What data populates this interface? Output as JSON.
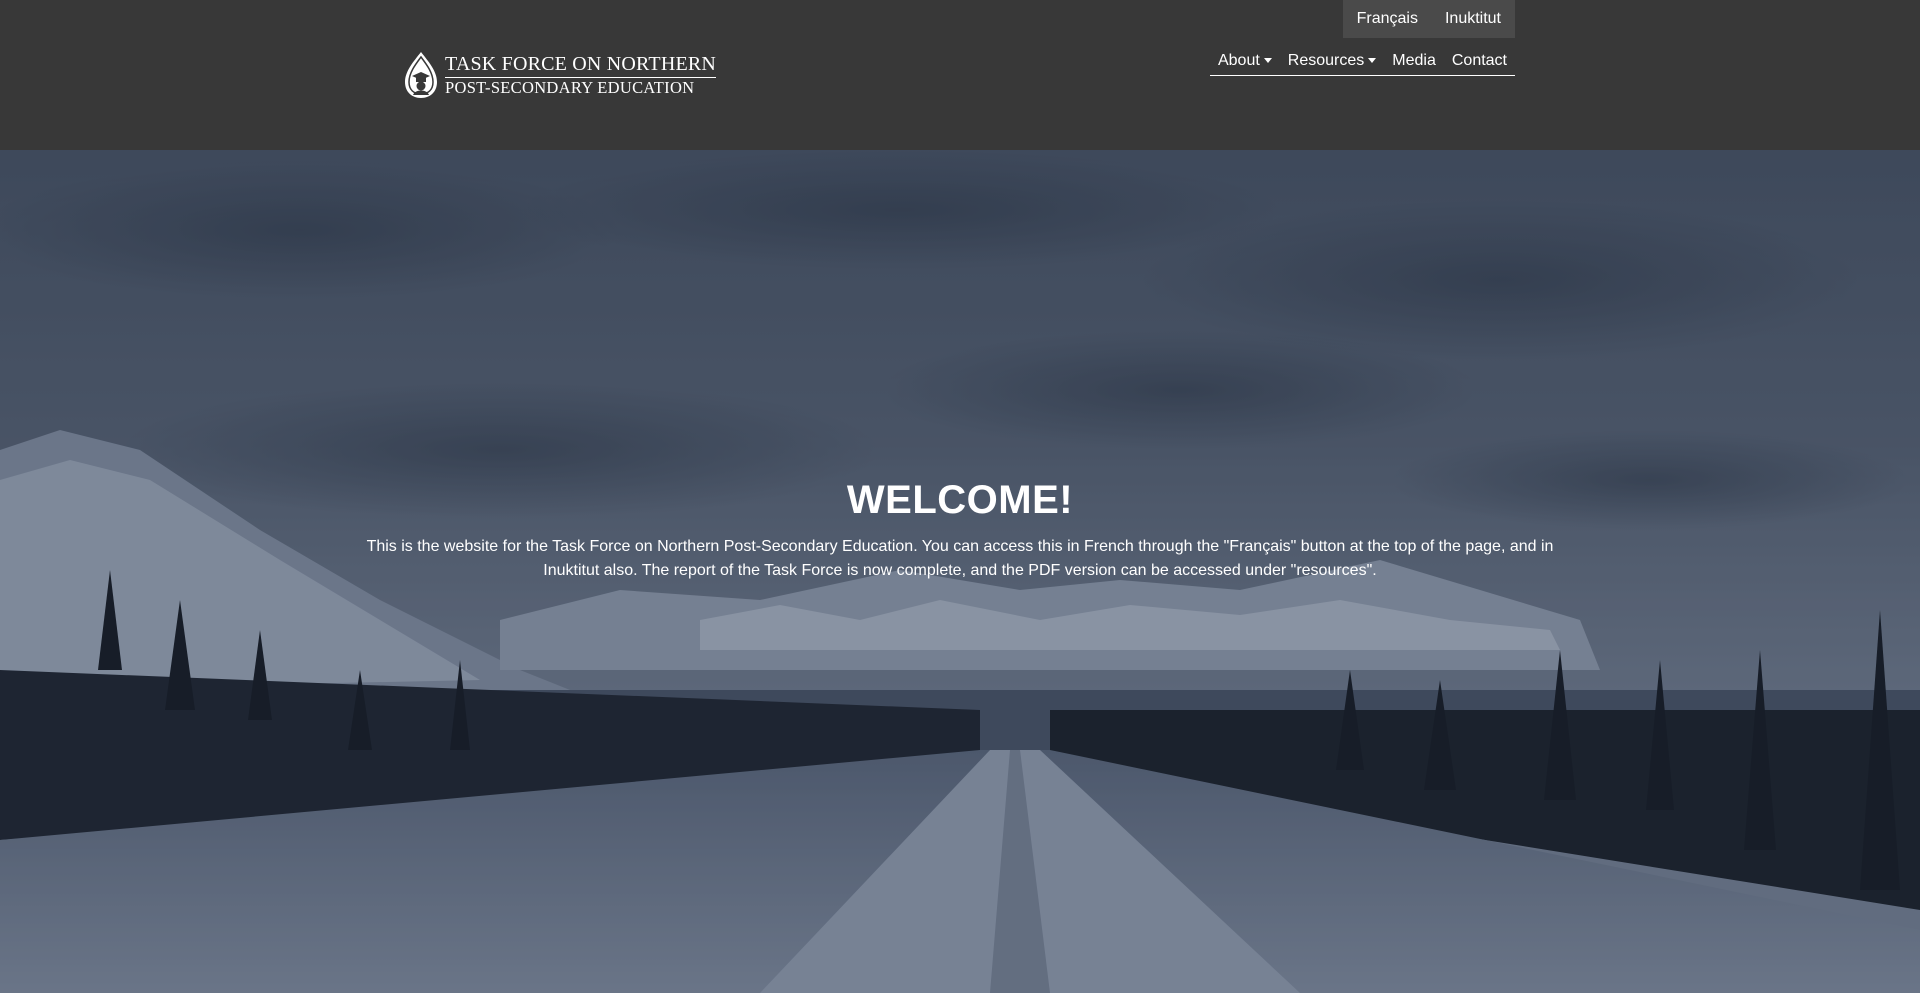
{
  "language_bar": {
    "french_label": "Français",
    "inuktitut_label": "Inuktitut"
  },
  "logo": {
    "line1": "TASK FORCE ON NORTHERN",
    "line2": "POST-SECONDARY EDUCATION",
    "icon": "teardrop-graduate-emblem-icon"
  },
  "nav": {
    "about_label": "About",
    "resources_label": "Resources",
    "media_label": "Media",
    "contact_label": "Contact"
  },
  "hero": {
    "title": "WELCOME!",
    "text": "This is the website for the Task Force on Northern Post-Secondary Education. You can access this in French through the \"Français\" button at the top of the page, and in Inuktitut also. The report of the Task Force is now complete, and the PDF version can be accessed under \"resources\".",
    "background": "snowy-mountain-road-photo"
  },
  "colors": {
    "header_bg": "#383838",
    "lang_bar_bg": "#4a4a4a",
    "text": "#ffffff"
  }
}
